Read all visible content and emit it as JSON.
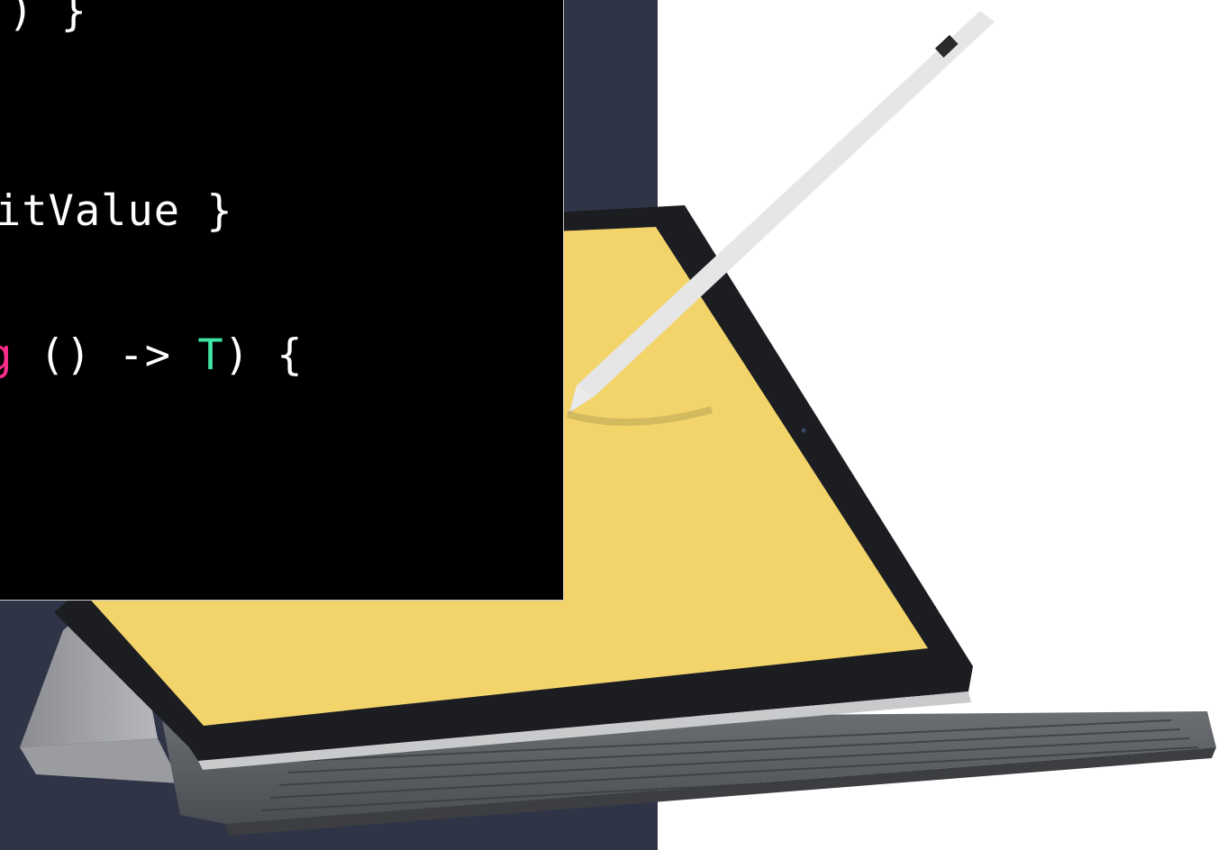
{
  "code": {
    "lines": [
      {
        "text": ") }"
      },
      {
        "text": "itValue }"
      },
      {
        "pre": "",
        "keyword": "g",
        "mid": " () -> ",
        "type": "T",
        "post": ") {"
      }
    ],
    "colors": {
      "background": "#000000",
      "text": "#ffffff",
      "keyword": "#ff2d8a",
      "type": "#3ee6a6"
    }
  },
  "illustration": {
    "device": "tablet-with-keyboard",
    "screen_color": "#f2d46b",
    "pencil": "stylus"
  },
  "background": {
    "panel_color": "#2f3447",
    "page_color": "#ffffff"
  }
}
